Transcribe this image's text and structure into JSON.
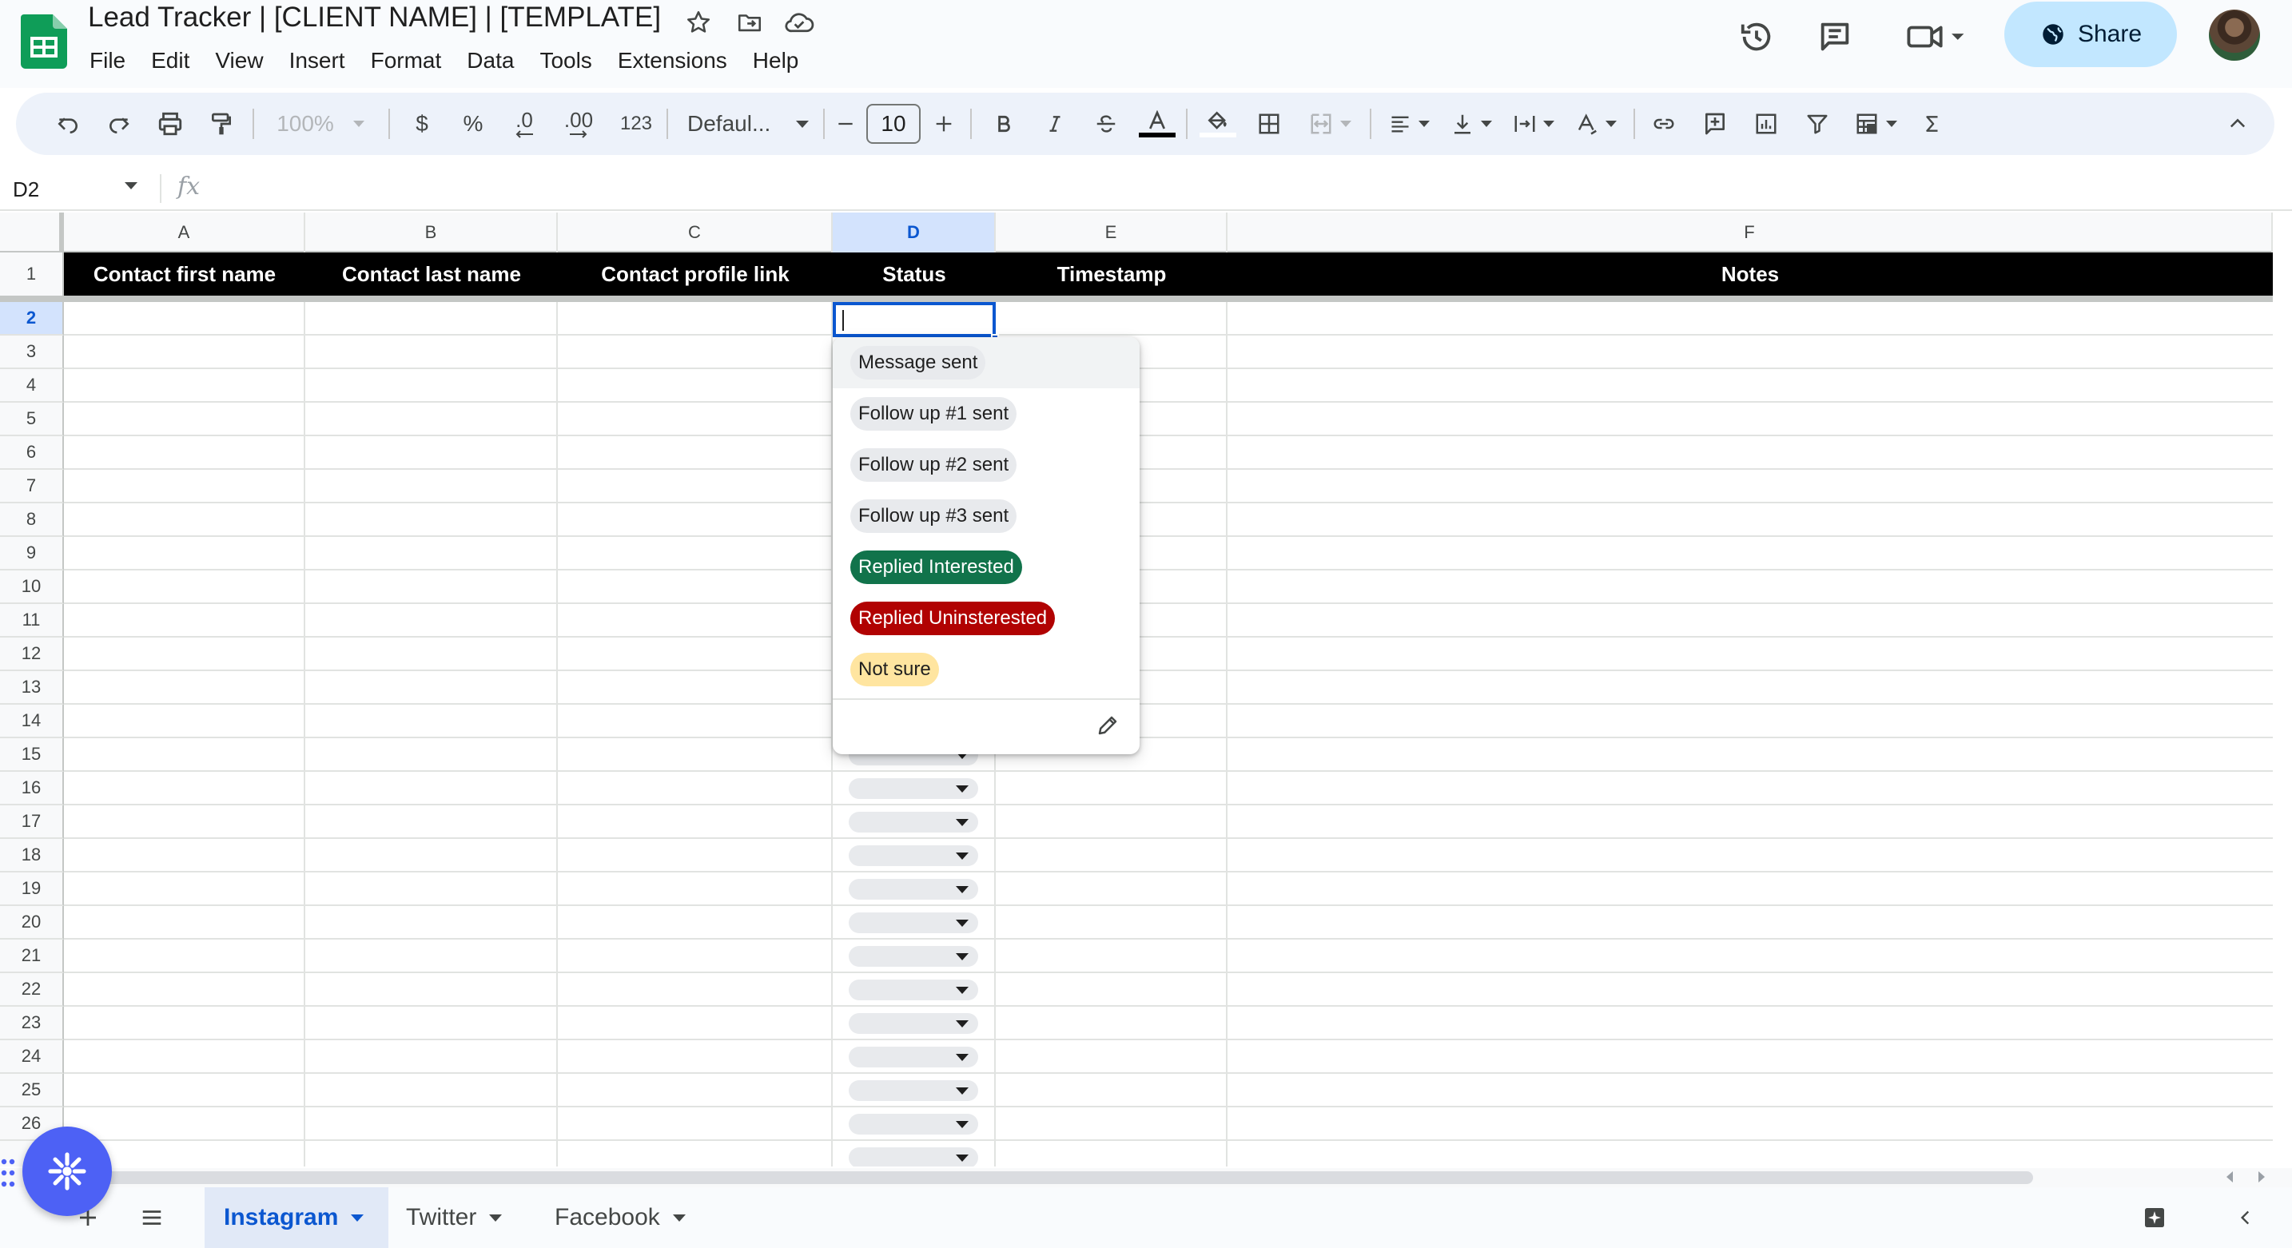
{
  "document": {
    "title": "Lead Tracker | [CLIENT NAME] | [TEMPLATE]"
  },
  "menu": [
    "File",
    "Edit",
    "View",
    "Insert",
    "Format",
    "Data",
    "Tools",
    "Extensions",
    "Help"
  ],
  "share": {
    "label": "Share"
  },
  "toolbar": {
    "zoom": "100%",
    "currency": "$",
    "percent": "%",
    "decrease_decimal": ".0",
    "increase_decimal": ".00",
    "number_format": "123",
    "font": "Defaul...",
    "font_size": "10"
  },
  "formula_bar": {
    "cell_ref": "D2",
    "fx": "fx"
  },
  "columns": [
    "A",
    "B",
    "C",
    "D",
    "E",
    "F"
  ],
  "header_row": [
    "Contact first name",
    "Contact last name",
    "Contact profile link",
    "Status",
    "Timestamp",
    "Notes"
  ],
  "rows": [
    "1",
    "2",
    "3",
    "4",
    "5",
    "6",
    "7",
    "8",
    "9",
    "10",
    "11",
    "12",
    "13",
    "14",
    "15",
    "16",
    "17",
    "18",
    "19",
    "20",
    "21",
    "22",
    "23",
    "24",
    "25",
    "26"
  ],
  "status_options": [
    {
      "label": "Message sent",
      "bg": "#e8eaed",
      "fg": "#1f1f1f"
    },
    {
      "label": "Follow up #1 sent",
      "bg": "#e8eaed",
      "fg": "#1f1f1f"
    },
    {
      "label": "Follow up #2 sent",
      "bg": "#e8eaed",
      "fg": "#1f1f1f"
    },
    {
      "label": "Follow up #3 sent",
      "bg": "#e8eaed",
      "fg": "#1f1f1f"
    },
    {
      "label": "Replied Interested",
      "bg": "#11734b",
      "fg": "#ffffff"
    },
    {
      "label": "Replied Uninsterested",
      "bg": "#b10202",
      "fg": "#ffffff"
    },
    {
      "label": "Not sure",
      "bg": "#ffe5a0",
      "fg": "#1f1f1f"
    }
  ],
  "sheets": [
    {
      "name": "Instagram",
      "active": true
    },
    {
      "name": "Twitter",
      "active": false
    },
    {
      "name": "Facebook",
      "active": false
    }
  ],
  "colors": {
    "accent": "#0b57d0",
    "share_bg": "#c2e7ff",
    "header_bg": "#000000",
    "sheets_green": "#0f9d58"
  }
}
